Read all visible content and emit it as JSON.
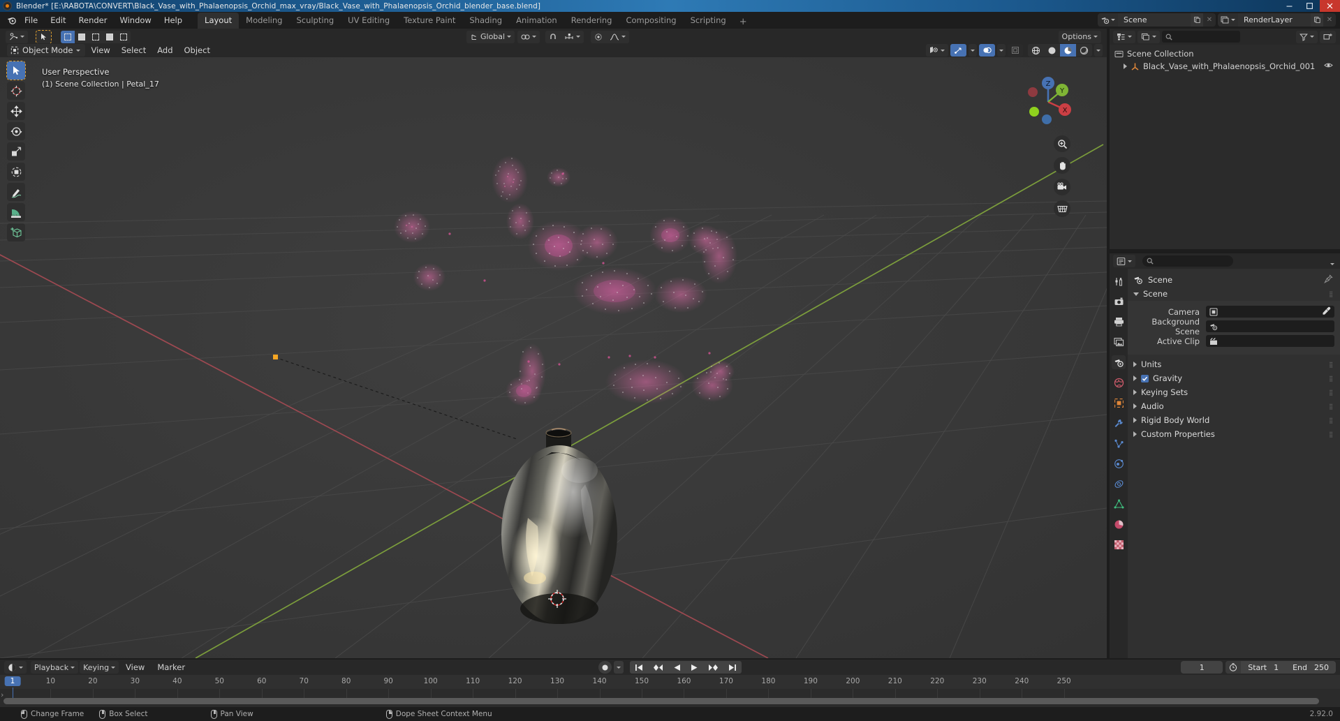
{
  "window": {
    "title": "Blender* [E:\\RABOTA\\CONVERT\\Black_Vase_with_Phalaenopsis_Orchid_max_vray/Black_Vase_with_Phalaenopsis_Orchid_blender_base.blend]",
    "minimize": "minimize-icon",
    "maximize": "maximize-icon",
    "close": "close-icon"
  },
  "topbar": {
    "menus": [
      "File",
      "Edit",
      "Render",
      "Window",
      "Help"
    ],
    "workspaces": [
      {
        "label": "Layout",
        "active": true
      },
      {
        "label": "Modeling",
        "active": false
      },
      {
        "label": "Sculpting",
        "active": false
      },
      {
        "label": "UV Editing",
        "active": false
      },
      {
        "label": "Texture Paint",
        "active": false
      },
      {
        "label": "Shading",
        "active": false
      },
      {
        "label": "Animation",
        "active": false
      },
      {
        "label": "Rendering",
        "active": false
      },
      {
        "label": "Compositing",
        "active": false
      },
      {
        "label": "Scripting",
        "active": false
      }
    ],
    "add_workspace": "+",
    "scene_name": "Scene",
    "viewlayer_name": "RenderLayer"
  },
  "viewport_header": {
    "editor_type": "editor-type-3d-viewport",
    "select_modes": [
      "tweak",
      "select-box",
      "select-circle",
      "select-lasso"
    ],
    "transform_orientation": "Global",
    "snap_label": "snapping",
    "proportional_label": "proportional-editing",
    "options_label": "Options",
    "mode": "Object Mode",
    "menus": [
      "View",
      "Select",
      "Add",
      "Object"
    ],
    "shading_modes": [
      "wireframe",
      "solid",
      "material-preview",
      "rendered"
    ],
    "shading_active": "material-preview"
  },
  "viewport": {
    "overlay_line1": "User Perspective",
    "overlay_line2": "(1) Scene Collection | Petal_17",
    "gizmo_axes": [
      {
        "label": "Z",
        "color": "#4772b3"
      },
      {
        "label": "Y",
        "color": "#7fb435"
      },
      {
        "label": "X",
        "color": "#cc3f44"
      }
    ],
    "nav_buttons": [
      "zoom-icon",
      "pan-hand-icon",
      "camera-icon",
      "ortho-persp-icon"
    ],
    "tools": [
      {
        "name": "tweak-tool",
        "active": true
      },
      {
        "name": "cursor-tool",
        "active": false
      },
      {
        "name": "move-tool",
        "active": false
      },
      {
        "name": "rotate-tool",
        "active": false
      },
      {
        "name": "scale-tool",
        "active": false
      },
      {
        "name": "transform-tool",
        "active": false
      },
      {
        "name": "annotate-tool",
        "active": false
      },
      {
        "name": "measure-tool",
        "active": false
      },
      {
        "name": "add-cube-tool",
        "active": false
      }
    ]
  },
  "outliner": {
    "display_mode": "View Layer",
    "search_placeholder": "",
    "rows": [
      {
        "label": "Scene Collection",
        "indent": 0,
        "icon": "collection-icon",
        "expander": false,
        "eye": false
      },
      {
        "label": "Black_Vase_with_Phalaenopsis_Orchid_001",
        "indent": 1,
        "icon": "empty-axes-icon",
        "expander": true,
        "eye": true
      }
    ]
  },
  "properties": {
    "search_placeholder": "",
    "breadcrumb": "Scene",
    "tabs": [
      {
        "name": "tool-tab",
        "icon": "wrench-screwdriver-icon",
        "active": false
      },
      {
        "name": "render-tab",
        "icon": "camera-back-icon",
        "active": false
      },
      {
        "name": "output-tab",
        "icon": "printer-icon",
        "active": false
      },
      {
        "name": "view-layer-tab",
        "icon": "images-icon",
        "active": false
      },
      {
        "name": "scene-tab",
        "icon": "scene-cone-icon",
        "active": true
      },
      {
        "name": "world-tab",
        "icon": "world-globe-icon",
        "active": false
      },
      {
        "name": "object-tab",
        "icon": "object-square-icon",
        "active": false
      },
      {
        "name": "modifier-tab",
        "icon": "wrench-icon",
        "active": false
      },
      {
        "name": "particles-tab",
        "icon": "particles-icon",
        "active": false
      },
      {
        "name": "physics-tab",
        "icon": "physics-orbit-icon",
        "active": false
      },
      {
        "name": "constraints-tab",
        "icon": "constraint-icon",
        "active": false
      },
      {
        "name": "data-tab",
        "icon": "mesh-data-icon",
        "active": false
      },
      {
        "name": "material-tab",
        "icon": "material-sphere-icon",
        "active": false
      },
      {
        "name": "texture-tab",
        "icon": "checker-texture-icon",
        "active": false
      }
    ],
    "panels": [
      {
        "label": "Scene",
        "open": true,
        "fields": [
          {
            "label": "Camera",
            "value": "",
            "icon": "camera-data-icon",
            "dropper": true
          },
          {
            "label": "Background Scene",
            "value": "",
            "icon": "scene-cone-icon",
            "dropper": false
          },
          {
            "label": "Active Clip",
            "value": "",
            "icon": "clapperboard-icon",
            "dropper": false
          }
        ]
      },
      {
        "label": "Units",
        "open": false,
        "checkbox": null
      },
      {
        "label": "Gravity",
        "open": false,
        "checkbox": true
      },
      {
        "label": "Keying Sets",
        "open": false,
        "checkbox": null
      },
      {
        "label": "Audio",
        "open": false,
        "checkbox": null
      },
      {
        "label": "Rigid Body World",
        "open": false,
        "checkbox": null
      },
      {
        "label": "Custom Properties",
        "open": false,
        "checkbox": null
      }
    ]
  },
  "timeline": {
    "editor_type": "timeline-editor-icon",
    "menus": [
      "Playback",
      "Keying",
      "View",
      "Marker"
    ],
    "ticks": [
      1,
      10,
      20,
      30,
      40,
      50,
      60,
      70,
      80,
      90,
      100,
      110,
      120,
      130,
      140,
      150,
      160,
      170,
      180,
      190,
      200,
      210,
      220,
      230,
      240,
      250
    ],
    "tick_min": 1,
    "tick_max": 256,
    "current_frame": 1,
    "current_frame_field": "1",
    "start_label": "Start",
    "start_value": "1",
    "end_label": "End",
    "end_value": "250",
    "playback_controls": [
      "jump-to-start",
      "prev-keyframe",
      "play-reverse",
      "play",
      "next-keyframe",
      "jump-to-end"
    ],
    "record_button": "auto-keying-icon"
  },
  "statusbar": {
    "items": [
      {
        "icon": "mouse-left-icon",
        "label": "Change Frame"
      },
      {
        "icon": "mouse-middle-icon",
        "label": "Box Select"
      },
      {
        "icon": "mouse-middle-icon",
        "label": "Pan View"
      },
      {
        "icon": "mouse-right-icon",
        "label": "Dope Sheet Context Menu"
      }
    ],
    "version": "2.92.0"
  },
  "colors": {
    "accent_blue": "#4772b3",
    "axis_x_red": "#cc3f44",
    "axis_y_green": "#7fb435",
    "title_blue": "#2e7ab5",
    "close_red": "#c8372c"
  }
}
